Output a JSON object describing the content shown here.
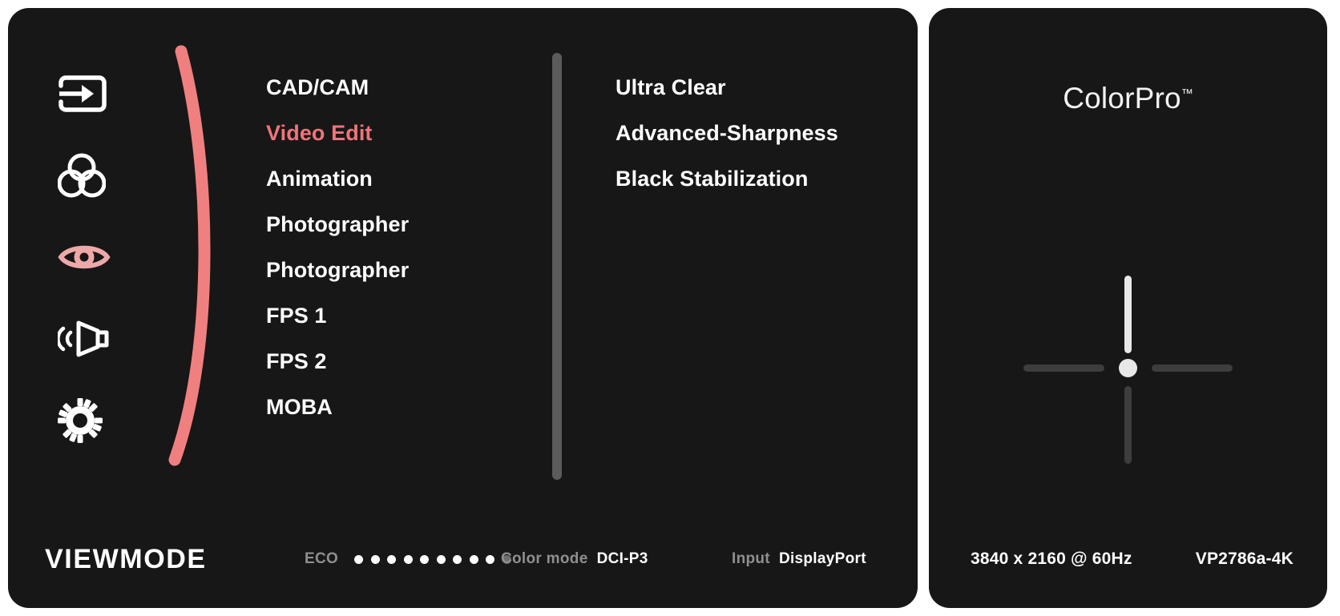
{
  "panel": {
    "sidebar": {
      "items": [
        {
          "icon": "input-source-icon",
          "label": "Input Source",
          "active": false
        },
        {
          "icon": "color-circles-icon",
          "label": "Color Settings",
          "active": false
        },
        {
          "icon": "eye-icon",
          "label": "View Mode",
          "active": true
        },
        {
          "icon": "speaker-icon",
          "label": "Audio Adjust",
          "active": false
        },
        {
          "icon": "gear-icon",
          "label": "Setup Menu",
          "active": false
        }
      ]
    },
    "menu_column_1": {
      "items": [
        {
          "label": "CAD/CAM",
          "selected": false
        },
        {
          "label": "Video Edit",
          "selected": true
        },
        {
          "label": "Animation",
          "selected": false
        },
        {
          "label": "Photographer",
          "selected": false
        },
        {
          "label": "Photographer",
          "selected": false
        },
        {
          "label": "FPS 1",
          "selected": false
        },
        {
          "label": "FPS 2",
          "selected": false
        },
        {
          "label": "MOBA",
          "selected": false
        }
      ]
    },
    "menu_column_2": {
      "items": [
        {
          "label": "Ultra Clear"
        },
        {
          "label": "Advanced-Sharpness"
        },
        {
          "label": "Black Stabilization"
        }
      ]
    },
    "status_bar": {
      "title": "VIEWMODE",
      "eco_key": "ECO",
      "eco_dots_total": 10,
      "eco_dots_on": 9,
      "color_mode_key": "Color mode",
      "color_mode_value": "DCI-P3",
      "input_key": "Input",
      "input_value": "DisplayPort"
    }
  },
  "side_panel": {
    "brand_name": "ColorPro",
    "brand_tm": "™",
    "navigation": {
      "up_active": true,
      "down_active": false,
      "left_active": false,
      "right_active": false
    },
    "resolution": "3840 x 2160 @ 60Hz",
    "model": "VP2786a-4K"
  },
  "colors": {
    "panel_background": "#171717",
    "accent_pink": "#F2737A",
    "curve_pink": "#F08080",
    "eye_icon_pink": "#EFA8A8",
    "scrollbar_grey": "#5b5b5b",
    "muted_text": "#8f8f8f",
    "arm_inactive": "#3d3d3d",
    "arm_active": "#e8e8e8"
  }
}
